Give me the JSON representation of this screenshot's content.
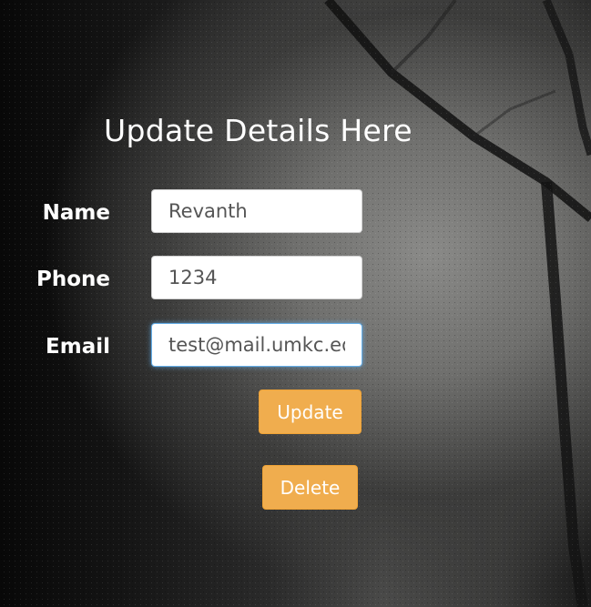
{
  "form": {
    "title": "Update Details Here",
    "fields": {
      "name": {
        "label": "Name",
        "value": "Revanth"
      },
      "phone": {
        "label": "Phone",
        "value": "1234"
      },
      "email": {
        "label": "Email",
        "value": "test@mail.umkc.edu"
      }
    },
    "update_label": "Update",
    "delete_label": "Delete"
  },
  "colors": {
    "button": "#f0ad4e",
    "focus_ring": "#66afe9"
  }
}
